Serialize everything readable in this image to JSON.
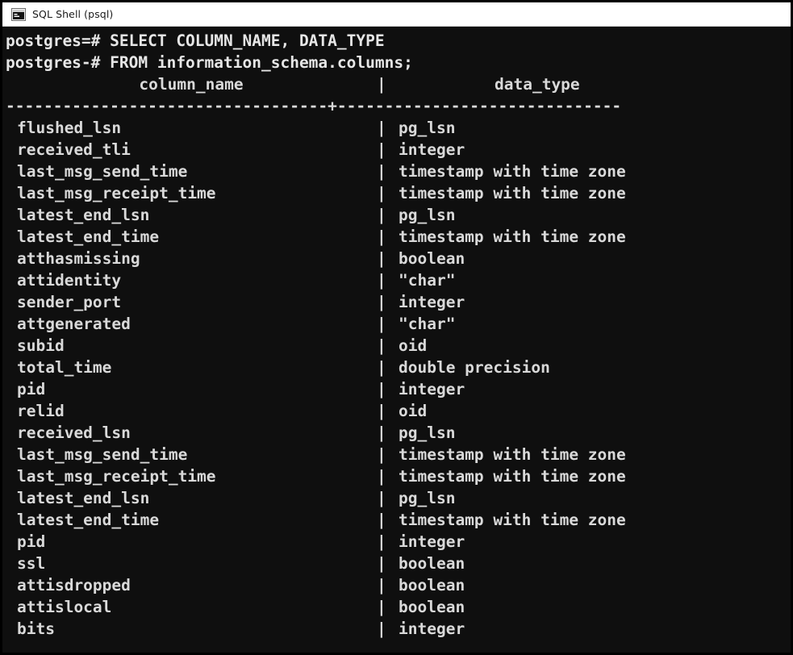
{
  "window": {
    "title": "SQL Shell (psql)",
    "icon": "console-window-icon",
    "background_color": "#0f0f0f",
    "text_color": "#d9d9d9",
    "titlebar_color": "#ffffff",
    "border_color": "#000000"
  },
  "terminal": {
    "command_lines": [
      "postgres=# SELECT COLUMN_NAME, DATA_TYPE",
      "postgres-# FROM information_schema.columns;"
    ],
    "prompt_primary": "postgres=#",
    "prompt_continuation": "postgres-#",
    "query_part_1": "SELECT COLUMN_NAME, DATA_TYPE",
    "query_part_2": "FROM information_schema.columns;",
    "headers": {
      "column_name": "column_name",
      "data_type": "data_type",
      "divider": "|"
    },
    "separator": "----------------------------------+------------------------------",
    "row_separator": "|",
    "rows": [
      {
        "column_name": "flushed_lsn",
        "data_type": "pg_lsn"
      },
      {
        "column_name": "received_tli",
        "data_type": "integer"
      },
      {
        "column_name": "last_msg_send_time",
        "data_type": "timestamp with time zone"
      },
      {
        "column_name": "last_msg_receipt_time",
        "data_type": "timestamp with time zone"
      },
      {
        "column_name": "latest_end_lsn",
        "data_type": "pg_lsn"
      },
      {
        "column_name": "latest_end_time",
        "data_type": "timestamp with time zone"
      },
      {
        "column_name": "atthasmissing",
        "data_type": "boolean"
      },
      {
        "column_name": "attidentity",
        "data_type": "\"char\""
      },
      {
        "column_name": "sender_port",
        "data_type": "integer"
      },
      {
        "column_name": "attgenerated",
        "data_type": "\"char\""
      },
      {
        "column_name": "subid",
        "data_type": "oid"
      },
      {
        "column_name": "total_time",
        "data_type": "double precision"
      },
      {
        "column_name": "pid",
        "data_type": "integer"
      },
      {
        "column_name": "relid",
        "data_type": "oid"
      },
      {
        "column_name": "received_lsn",
        "data_type": "pg_lsn"
      },
      {
        "column_name": "last_msg_send_time",
        "data_type": "timestamp with time zone"
      },
      {
        "column_name": "last_msg_receipt_time",
        "data_type": "timestamp with time zone"
      },
      {
        "column_name": "latest_end_lsn",
        "data_type": "pg_lsn"
      },
      {
        "column_name": "latest_end_time",
        "data_type": "timestamp with time zone"
      },
      {
        "column_name": "pid",
        "data_type": "integer"
      },
      {
        "column_name": "ssl",
        "data_type": "boolean"
      },
      {
        "column_name": "attisdropped",
        "data_type": "boolean"
      },
      {
        "column_name": "attislocal",
        "data_type": "boolean"
      },
      {
        "column_name": "bits",
        "data_type": "integer"
      }
    ]
  }
}
